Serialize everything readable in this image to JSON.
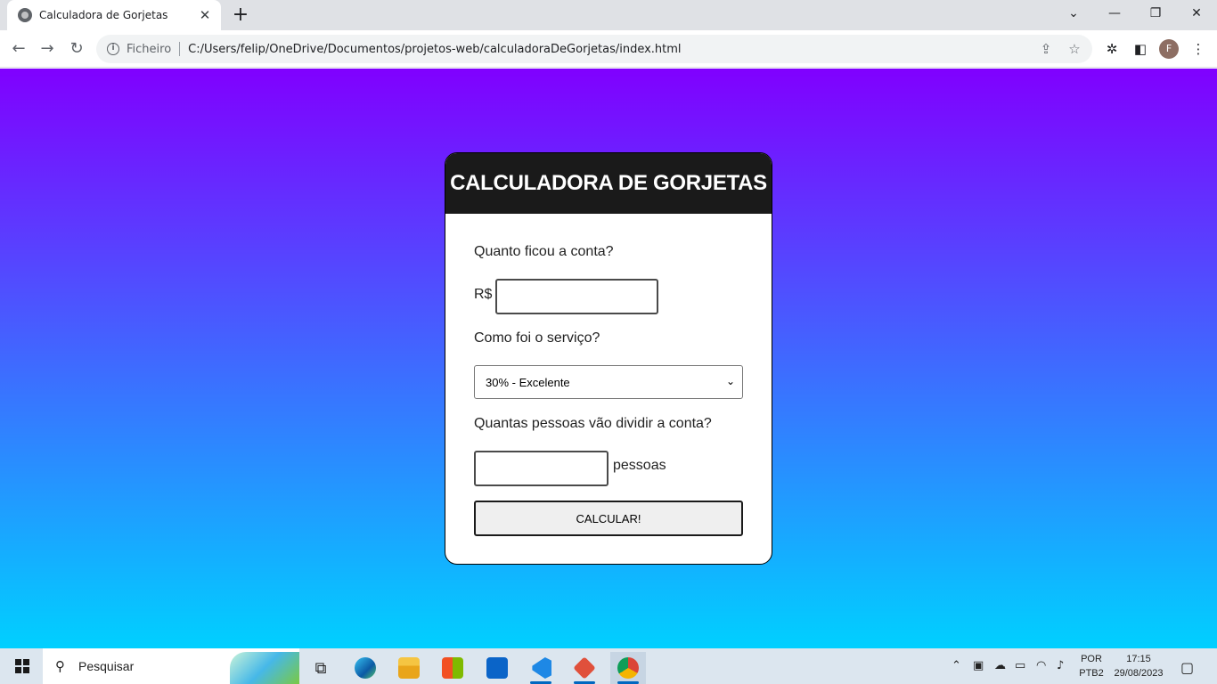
{
  "browser": {
    "tab": {
      "title": "Calculadora de Gorjetas",
      "favicon": "globe-icon"
    },
    "new_tab_label": "+",
    "address": {
      "chip": "Ficheiro",
      "url": "C:/Users/felip/OneDrive/Documentos/projetos-web/calculadoraDeGorjetas/index.html"
    },
    "profile_initial": "F"
  },
  "page": {
    "title": "CALCULADORA DE GORJETAS",
    "bill": {
      "label": "Quanto ficou a conta?",
      "prefix": "R$",
      "value": ""
    },
    "service": {
      "label": "Como foi o serviço?",
      "selected": "30% - Excelente"
    },
    "people": {
      "label": "Quantas pessoas vão dividir a conta?",
      "suffix": "pessoas",
      "value": ""
    },
    "button_label": "CALCULAR!",
    "colors": {
      "gradient_top": "#8000ff",
      "gradient_bottom": "#00d0ff",
      "header_bg": "#1a1a1a"
    }
  },
  "taskbar": {
    "search_placeholder": "Pesquisar",
    "language": {
      "line1": "POR",
      "line2": "PTB2"
    },
    "time": "17:15",
    "date": "29/08/2023",
    "apps": [
      "task-view",
      "edge",
      "file-explorer",
      "microsoft-store",
      "mail",
      "vscode",
      "git",
      "chrome"
    ]
  }
}
